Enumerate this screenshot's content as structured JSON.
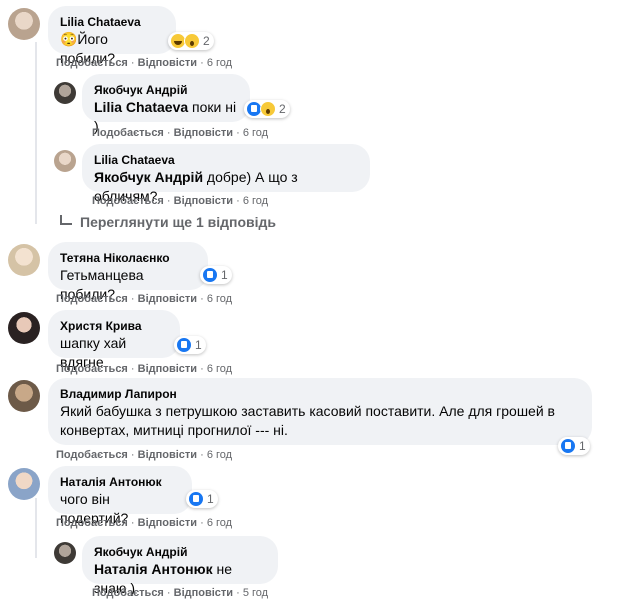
{
  "comments": [
    {
      "author": "Lilia Chataeva",
      "text": "😳Його побили?",
      "reaction_count": "2",
      "like": "Подобається",
      "reply": "Відповісти",
      "time": "6 год"
    },
    {
      "author": "Якобчук Андрій",
      "mention": "Lilia Chataeva",
      "text": " поки ні )",
      "reaction_count": "2",
      "like": "Подобається",
      "reply": "Відповісти",
      "time": "6 год"
    },
    {
      "author": "Lilia Chataeva",
      "mention": "Якобчук Андрій",
      "text": " добре) А що з обличям?",
      "like": "Подобається",
      "reply": "Відповісти",
      "time": "6 год"
    },
    {
      "author": "Тетяна Ніколаєнко",
      "text": "Гетьманцева побили?",
      "reaction_count": "1",
      "like": "Подобається",
      "reply": "Відповісти",
      "time": "6 год"
    },
    {
      "author": "Христя Крива",
      "text": "шапку хай вдягне",
      "reaction_count": "1",
      "like": "Подобається",
      "reply": "Відповісти",
      "time": "6 год"
    },
    {
      "author": "Владимир Лапирон",
      "text": "Який бабушка з петрушкою заставить касовий поставити. Але для грошей в конвертах, митниці прогнилої --- ні.",
      "reaction_count": "1",
      "like": "Подобається",
      "reply": "Відповісти",
      "time": "6 год"
    },
    {
      "author": "Наталія Антонюк",
      "text": "чого він подертий?",
      "reaction_count": "1",
      "like": "Подобається",
      "reply": "Відповісти",
      "time": "6 год"
    },
    {
      "author": "Якобчук Андрій",
      "mention": "Наталія Антонюк",
      "text": " не знаю )",
      "like": "Подобається",
      "reply": "Відповісти",
      "time": "5 год"
    }
  ],
  "more_replies": "Переглянути ще 1 відповідь",
  "sep": " · ",
  "colors": {
    "bubble": "#f0f2f5",
    "meta": "#65676b",
    "like": "#1877f2"
  }
}
